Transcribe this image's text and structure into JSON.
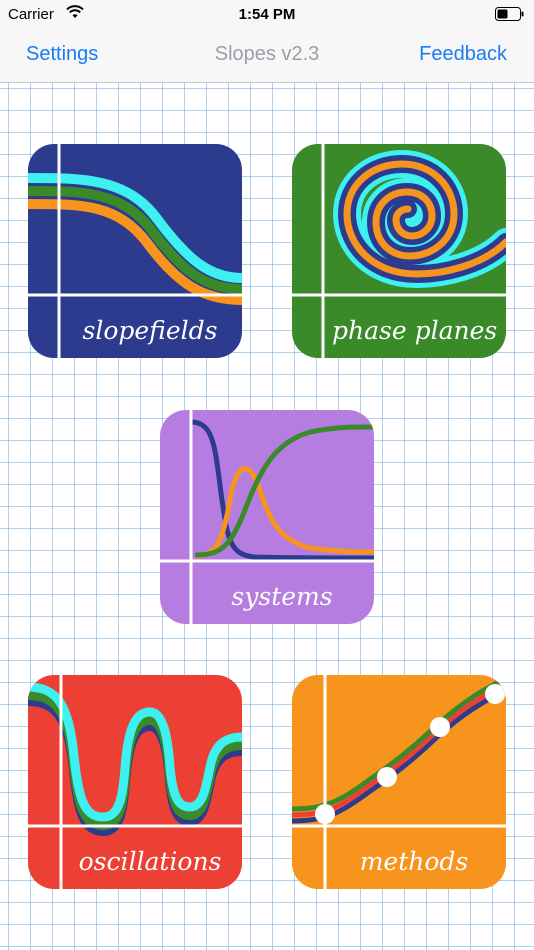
{
  "status_bar": {
    "carrier": "Carrier",
    "time": "1:54 PM"
  },
  "nav": {
    "left_button": "Settings",
    "title": "Slopes v2.3",
    "right_button": "Feedback"
  },
  "tiles": [
    {
      "id": "slopefields",
      "label": "slopefields",
      "color": "#2d3b8e"
    },
    {
      "id": "phase_planes",
      "label": "phase planes",
      "color": "#3a8a2a"
    },
    {
      "id": "systems",
      "label": "systems",
      "color": "#b57de0"
    },
    {
      "id": "oscillations",
      "label": "oscillations",
      "color": "#ec4034"
    },
    {
      "id": "methods",
      "label": "methods",
      "color": "#f7941e"
    }
  ],
  "colors": {
    "cyan": "#3ef0f0",
    "green": "#3a8a2a",
    "orange": "#f7941e",
    "navy": "#2d3b8e",
    "link_blue": "#1a7cf2"
  }
}
